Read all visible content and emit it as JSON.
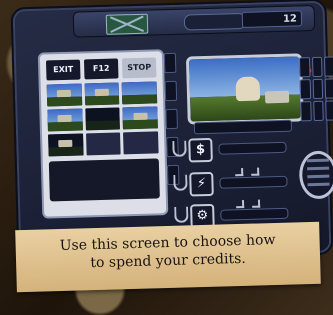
{
  "header": {
    "counter": "12"
  },
  "browser": {
    "tabs": [
      {
        "label": "EXIT",
        "active": false
      },
      {
        "label": "F12",
        "active": false
      },
      {
        "label": "STOP",
        "active": true
      }
    ]
  },
  "actions": [
    {
      "icon": "dollar-icon",
      "glyph": "$"
    },
    {
      "icon": "lightning-icon",
      "glyph": "⚡"
    },
    {
      "icon": "gear-icon",
      "glyph": "⚙"
    }
  ],
  "caption": {
    "line1": "Use this screen to choose how",
    "line2": "to spend your credits."
  }
}
